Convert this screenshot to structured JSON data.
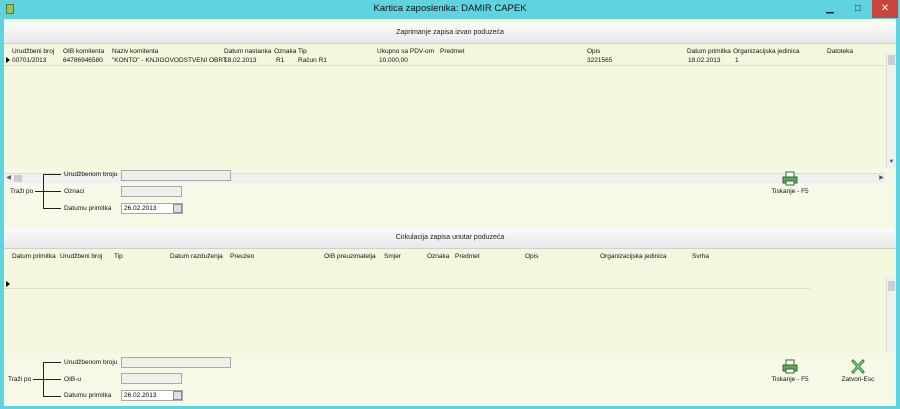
{
  "window": {
    "title": "Kartica zaposlenika: DAMIR CAPEK",
    "controls": {
      "minimize": "▁",
      "maximize": "□",
      "close": "✕"
    }
  },
  "section1": {
    "header": "Zaprimanje zapisa izvan poduzeća",
    "columns": [
      "Urudžbeni broj",
      "OIB komitenta",
      "Naziv komitenta",
      "Datum nastanka",
      "Oznaka",
      "Tip",
      "Ukupno sa PDV-om",
      "Predmet",
      "Opis",
      "Datum primitka",
      "Organizacijska jedinica",
      "Datoteka"
    ],
    "rows": [
      [
        "00701/2013",
        "64786946580",
        "\"KONTO\" - KNJIGOVODSTVENI OBRT",
        "18.02.2013",
        "R1",
        "Račun R1",
        "10.000,00",
        "",
        "3221565",
        "18.02.2013",
        "1",
        ""
      ]
    ],
    "search": {
      "trazi_po": "Traži po",
      "options": [
        "Urudžbenom broju",
        "Oznaci",
        "Datumu primitka"
      ],
      "values": [
        "",
        "",
        "26.02.2013"
      ]
    },
    "print_label": "Tiskanje - F5"
  },
  "section2": {
    "header": "Cirkulacija zapisa unutar poduzeća",
    "columns": [
      "Datum primitka",
      "Urudžbeni broj",
      "Tip",
      "Datum razduženja",
      "Preuzeo",
      "OIB preuzimatelja",
      "Smjer",
      "Oznaka",
      "Predmet",
      "Opis",
      "Organizacijska jedinica",
      "Svrha"
    ],
    "search": {
      "trazi_po": "Traži po",
      "options": [
        "Urudžbenom broju",
        "OIB-u",
        "Datumu primitka"
      ],
      "values": [
        "",
        "",
        "26.02.2013"
      ]
    },
    "print_label": "Tiskanje - F5",
    "close_label": "Zatvori-Esc"
  },
  "colors": {
    "window_frame": "#5fd3df",
    "client_bg": "#f5f9e6",
    "close_button": "#c7453a"
  }
}
